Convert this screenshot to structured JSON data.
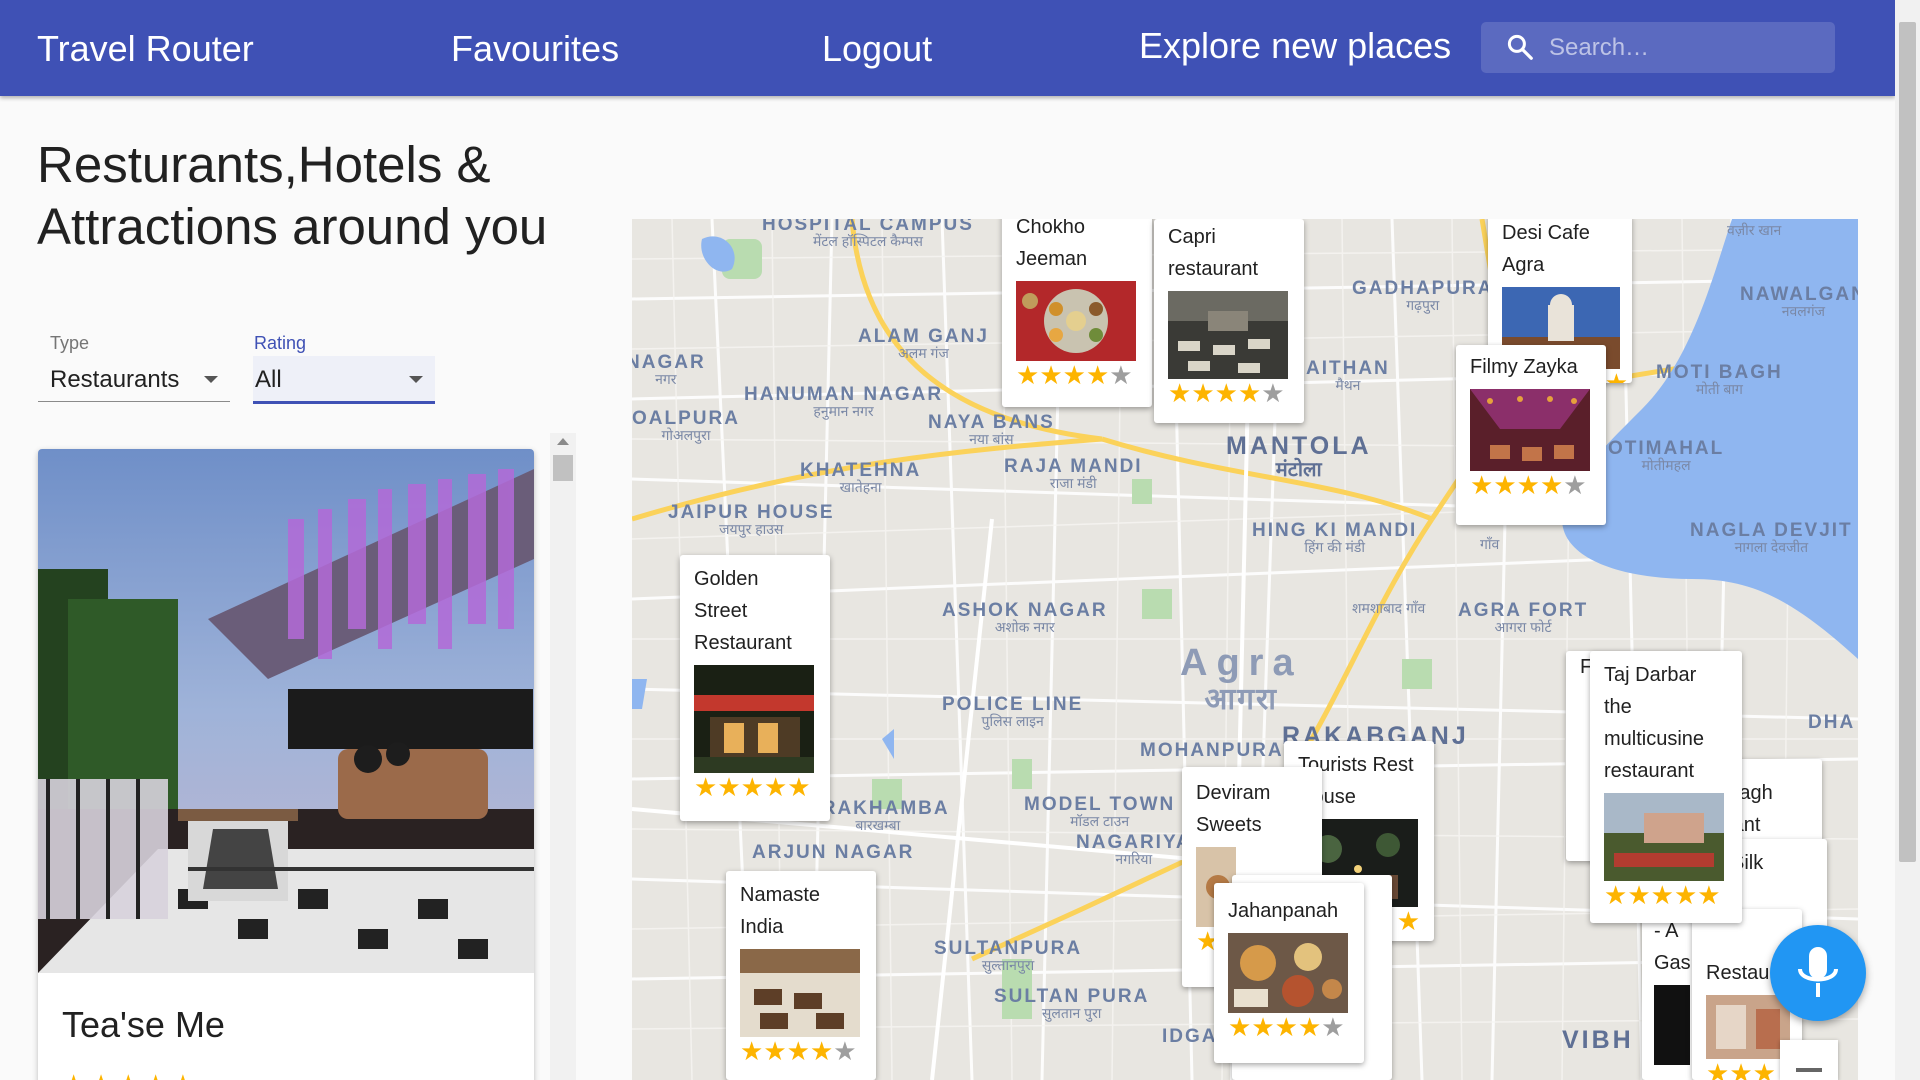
{
  "header": {
    "app_title": "Travel Router",
    "nav_favourites": "Favourites",
    "nav_logout": "Logout",
    "nav_explore": "Explore new places",
    "search_placeholder": "Search…"
  },
  "page": {
    "heading": "Resturants,Hotels & Attractions around you"
  },
  "filters": {
    "type_label": "Type",
    "type_value": "Restaurants",
    "rating_label": "Rating",
    "rating_value": "All"
  },
  "list": {
    "cards": [
      {
        "name": "Tea'se Me",
        "rating": 5
      }
    ]
  },
  "map": {
    "labels": {
      "hospital_campus": "HOSPITAL CAMPUS",
      "hospital_campus_hi": "मेंटल हॉस्पिटल कैम्पस",
      "alam_ganj": "ALAM GANJ",
      "alam_ganj_hi": "अलम गंज",
      "gadhapura": "GADHAPURA",
      "gadhapura_hi": "गढ़पुरा",
      "wazir_khan_hi": "वज़ीर खान",
      "nawalganj": "NAWALGAN",
      "nawalganj_hi": "नवलगंज",
      "nagar": "NAGAR",
      "nagar_hi": "नगर",
      "hanuman_nagar": "HANUMAN NAGAR",
      "hanuman_nagar_hi": "हनुमान नगर",
      "naya_bans": "NAYA BANS",
      "naya_bans_hi": "नया बांस",
      "raja_mandi": "RAJA MANDI",
      "raja_mandi_hi": "राजा मंडी",
      "mantola": "MANTOLA",
      "mantola_hi": "मंटोला",
      "maithan": "AITHAN",
      "maithan_hi": "मैथन",
      "moti_bagh": "MOTI BAGH",
      "moti_bagh_hi": "मोती बाग",
      "otimahal": "OTIMAHAL",
      "otimahal_hi": "मोतीमहल",
      "dalpura": "OALPURA",
      "dalpura_hi": "गोअलपुरा",
      "khatehna": "KHATEHNA",
      "khatehna_hi": "खातेहना",
      "jaipur_house": "JAIPUR HOUSE",
      "jaipur_house_hi": "जयपुर हाउस",
      "hing_ki_mandi": "HING KI MANDI",
      "hing_ki_mandi_hi": "हिंग की मंडी",
      "nagla_devjit": "NAGLA DEVJIT",
      "nagla_devjit_hi": "नागला देवजीत",
      "ashok_nagar": "ASHOK NAGAR",
      "ashok_nagar_hi": "अशोक नगर",
      "shamshabad_hi": "शमशाबाद गाँव",
      "agra_fort": "AGRA FORT",
      "agra_fort_hi": "आगरा फोर्ट",
      "agra": "Agra",
      "agra_hi": "आगरा",
      "police_line": "POLICE LINE",
      "police_line_hi": "पुलिस लाइन",
      "mohanpura": "MOHANPURA",
      "rakabganj": "RAKABGANJ",
      "arakhamba": "ARAKHAMBA",
      "arakhamba_hi": "बारखम्बा",
      "arjun_nagar": "ARJUN NAGAR",
      "model_town": "MODEL TOWN",
      "model_town_hi": "मॉडल टाउन",
      "nagariya": "NAGARIYA",
      "nagariya_hi": "नगरिया",
      "sultanpura": "SULTANPURA",
      "sultanpura_hi": "सुल्तानपुरा",
      "sultan_pura": "SULTAN PURA",
      "sultan_pura_hi": "सुलतान पुरा",
      "idga": "IDGA",
      "vibh": "VIBH",
      "dha": "DHA",
      "taj_hi": "गाँव"
    },
    "markers": [
      {
        "name": "Chokho Jeeman",
        "rating": 4
      },
      {
        "name": "Capri restaurant",
        "rating": 4
      },
      {
        "name": "Desi Cafe Agra",
        "rating": 1
      },
      {
        "name": "Filmy Zayka",
        "rating": 4
      },
      {
        "name": "Golden Street Restaurant",
        "rating": 5
      },
      {
        "name": "Taj Darbar the multicusine restaurant",
        "rating": 5
      },
      {
        "name": "Tourists Rest House",
        "rating": 1
      },
      {
        "name": "Deviram Sweets",
        "rating": 1
      },
      {
        "name": "Jahanpanah",
        "rating": 4
      },
      {
        "name": "Namaste India",
        "rating": 4
      },
      {
        "name": "Bagh",
        "rating": 0
      },
      {
        "name": "Silk",
        "rating": 0
      },
      {
        "name": "- A Gas",
        "rating": 0
      },
      {
        "name": "Restaurant",
        "rating": 3
      },
      {
        "name": "rant",
        "rating": 0
      },
      {
        "name": "e",
        "rating": 0
      },
      {
        "name": "F",
        "rating": 0
      },
      {
        "name": "D",
        "rating": 0
      }
    ]
  },
  "colors": {
    "primary": "#3f51b5",
    "accent": "#2196f3",
    "star": "#fdb400",
    "star_empty": "#9e9e9e",
    "map_water": "#8fb6f0",
    "map_park": "#a9d9a0",
    "map_road": "#fbd25a"
  },
  "icons": [
    "search-icon",
    "dropdown-caret-icon",
    "star-icon",
    "mic-icon",
    "zoom-out-icon"
  ]
}
